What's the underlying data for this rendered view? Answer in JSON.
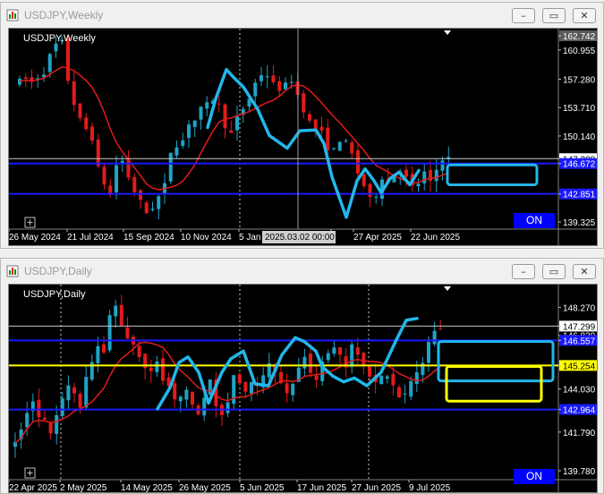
{
  "weekly": {
    "window_title": "USDJPY,Weekly",
    "symbol_label": "USDJPY,Weekly",
    "on_label": "ON",
    "crosshair_label": "2025.03.02 00:00",
    "price_labels": [
      {
        "text": "162.742",
        "price": 162.742,
        "style": "top"
      },
      {
        "text": "160.955",
        "price": 160.955,
        "style": "normal"
      },
      {
        "text": "157.280",
        "price": 157.28,
        "style": "normal"
      },
      {
        "text": "153.710",
        "price": 153.71,
        "style": "normal"
      },
      {
        "text": "150.140",
        "price": 150.14,
        "style": "normal"
      },
      {
        "text": "147.288",
        "price": 147.288,
        "style": "white"
      },
      {
        "text": "146.672",
        "price": 146.672,
        "style": "blue"
      },
      {
        "text": "142.851",
        "price": 142.851,
        "style": "blue"
      },
      {
        "text": "139.325",
        "price": 139.325,
        "style": "normal"
      }
    ],
    "date_labels": [
      "26 May 2024",
      "21 Jul 2024",
      "15 Sep 2024",
      "10 Nov 2024",
      "5 Jan",
      "5",
      "27 Apr 2025",
      "22 Jun 2025"
    ],
    "colors": {
      "bull": "#1fa3c6",
      "bear": "#e21b1b",
      "ma": "#e21b1b",
      "blue_line": "#1a1aff",
      "drawing": "#22b7ea"
    }
  },
  "daily": {
    "window_title": "USDJPY,Daily",
    "symbol_label": "USDJPY,Daily",
    "on_label": "ON",
    "price_labels": [
      {
        "text": "148.270",
        "price": 148.27,
        "style": "normal"
      },
      {
        "text": "147.299",
        "price": 147.299,
        "style": "white"
      },
      {
        "text": "146.820",
        "price": 146.82,
        "style": "normal"
      },
      {
        "text": "146.557",
        "price": 146.557,
        "style": "blue"
      },
      {
        "text": "145.254",
        "price": 145.254,
        "style": "yellow"
      },
      {
        "text": "144.030",
        "price": 144.03,
        "style": "normal"
      },
      {
        "text": "142.964",
        "price": 142.964,
        "style": "blue"
      },
      {
        "text": "141.790",
        "price": 141.79,
        "style": "normal"
      },
      {
        "text": "139.780",
        "price": 139.78,
        "style": "normal"
      }
    ],
    "date_labels": [
      "22 Apr 2025",
      "2 May 2025",
      "14 May 2025",
      "26 May 2025",
      "5 Jun 2025",
      "17 Jun 2025",
      "27 Jun 2025",
      "9 Jul 2025"
    ],
    "colors": {
      "bull": "#1fa3c6",
      "bear": "#e21b1b",
      "ma": "#e21b1b",
      "blue_line": "#1a1aff",
      "yellow_line": "#ffff00",
      "drawing": "#22b7ea"
    }
  },
  "window_buttons": {
    "minimize": "–",
    "restore": "▭",
    "close": "✕"
  }
}
